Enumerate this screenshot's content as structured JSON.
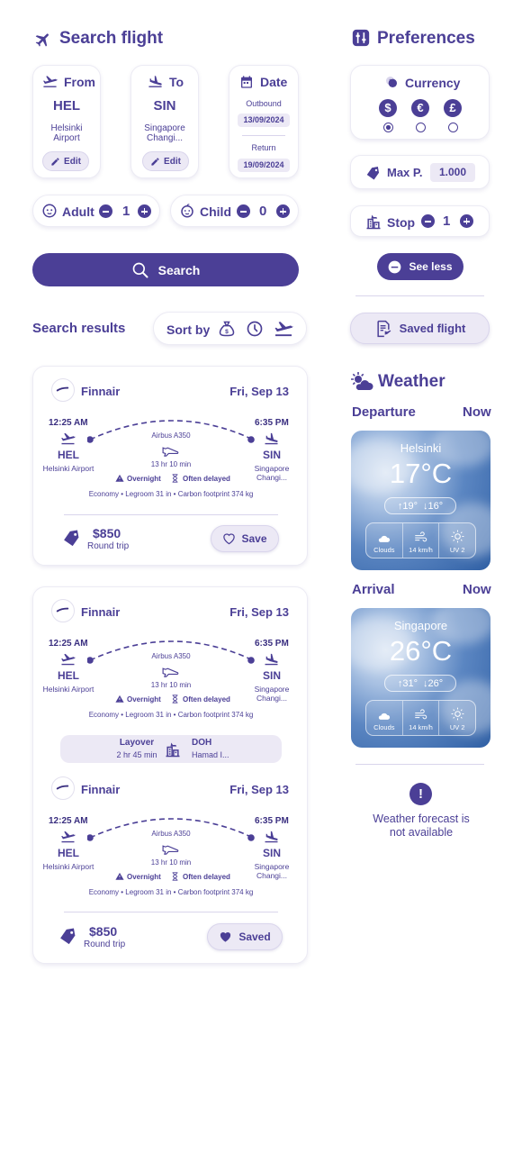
{
  "search": {
    "title": "Search flight",
    "from": {
      "label": "From",
      "code": "HEL",
      "name": "Helsinki Airport",
      "edit": "Edit"
    },
    "to": {
      "label": "To",
      "code": "SIN",
      "name": "Singapore Changi...",
      "edit": "Edit"
    },
    "date": {
      "label": "Date",
      "outbound_label": "Outbound",
      "outbound": "13/09/2024",
      "return_label": "Return",
      "return": "19/09/2024"
    },
    "adult": {
      "label": "Adult",
      "count": "1"
    },
    "child": {
      "label": "Child",
      "count": "0"
    },
    "button": "Search"
  },
  "preferences": {
    "title": "Preferences",
    "currency_label": "Currency",
    "currencies": [
      "$",
      "€",
      "£"
    ],
    "selected_currency": "$",
    "max_price_label": "Max P.",
    "max_price": "1.000",
    "stop_label": "Stop",
    "stop_count": "1",
    "see_less": "See less",
    "saved_flight": "Saved flight"
  },
  "results": {
    "title": "Search results",
    "sort_label": "Sort by",
    "sort_icons": [
      "money-bag-icon",
      "clock-icon",
      "departure-icon"
    ],
    "cards": [
      {
        "save_label": "Save",
        "price": "$850",
        "price_type": "Round trip",
        "segments": [
          {
            "airline": "Finnair",
            "date": "Fri, Sep 13",
            "dep_time": "12:25 AM",
            "arr_time": "6:35 PM",
            "dep_code": "HEL",
            "arr_code": "SIN",
            "dep_name": "Helsinki Airport",
            "arr_name": "Singapore Changi...",
            "aircraft": "Airbus A350",
            "duration": "13 hr 10 min",
            "warn1": "Overnight",
            "warn2": "Often delayed",
            "details": "Economy • Legroom 31 in • Carbon footprint 374 kg"
          }
        ]
      },
      {
        "save_label": "Saved",
        "price": "$850",
        "price_type": "Round trip",
        "layover": {
          "label": "Layover",
          "duration": "2 hr 45 min",
          "code": "DOH",
          "name": "Hamad I..."
        },
        "segments": [
          {
            "airline": "Finnair",
            "date": "Fri, Sep 13",
            "dep_time": "12:25 AM",
            "arr_time": "6:35 PM",
            "dep_code": "HEL",
            "arr_code": "SIN",
            "dep_name": "Helsinki Airport",
            "arr_name": "Singapore Changi...",
            "aircraft": "Airbus A350",
            "duration": "13 hr 10 min",
            "warn1": "Overnight",
            "warn2": "Often delayed",
            "details": "Economy • Legroom 31 in • Carbon footprint 374 kg"
          },
          {
            "airline": "Finnair",
            "date": "Fri, Sep 13",
            "dep_time": "12:25 AM",
            "arr_time": "6:35 PM",
            "dep_code": "HEL",
            "arr_code": "SIN",
            "dep_name": "Helsinki Airport",
            "arr_name": "Singapore Changi...",
            "aircraft": "Airbus A350",
            "duration": "13 hr 10 min",
            "warn1": "Overnight",
            "warn2": "Often delayed",
            "details": "Economy • Legroom 31 in • Carbon footprint 374 kg"
          }
        ]
      }
    ]
  },
  "weather": {
    "title": "Weather",
    "departure": {
      "label": "Departure",
      "when": "Now",
      "city": "Helsinki",
      "temp": "17°C",
      "high": "↑19°",
      "low": "↓16°",
      "condition": "Clouds",
      "wind": "14 km/h",
      "uv": "UV 2"
    },
    "arrival": {
      "label": "Arrival",
      "when": "Now",
      "city": "Singapore",
      "temp": "26°C",
      "high": "↑31°",
      "low": "↓26°",
      "condition": "Clouds",
      "wind": "14 km/h",
      "uv": "UV 2"
    },
    "forecast_message": "Weather forecast is not available"
  },
  "colors": {
    "primary": "#4b3f96",
    "chip": "#ece9f5",
    "border": "#ecebf4"
  }
}
